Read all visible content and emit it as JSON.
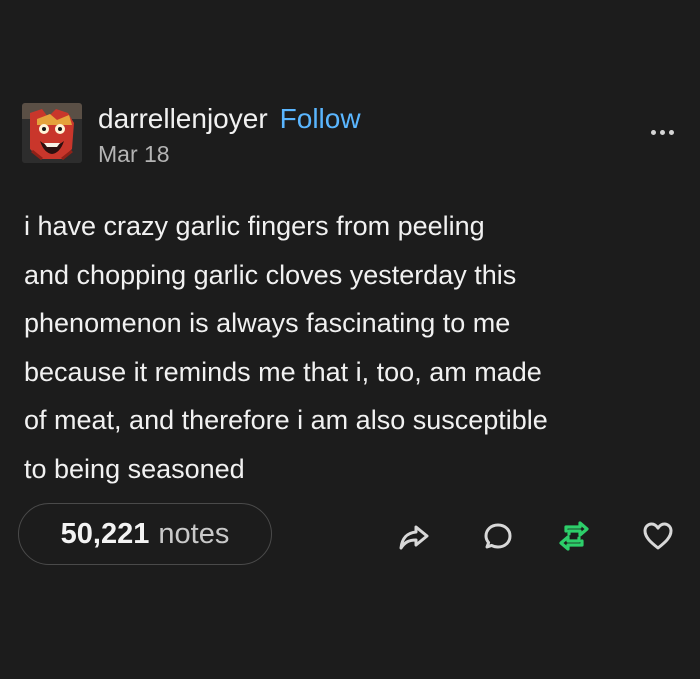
{
  "post": {
    "author": {
      "username": "darrellenjoyer",
      "follow_label": "Follow",
      "date": "Mar 18"
    },
    "body": "i have crazy garlic fingers from peeling\nand chopping garlic cloves yesterday this\nphenomenon is always fascinating to me\nbecause it reminds me that i, too, am made\nof meat, and therefore i am also susceptible\nto being seasoned",
    "notes": {
      "count": "50,221",
      "label": "notes"
    },
    "actions": {
      "share_icon": "share-icon",
      "reply_icon": "reply-icon",
      "reblog_icon": "reblog-icon",
      "like_icon": "heart-icon"
    }
  },
  "colors": {
    "background": "#1c1c1c",
    "text": "#f1f1f1",
    "follow": "#5ab6ff",
    "reblog": "#2dce6a",
    "muted": "#b4b4b4"
  }
}
